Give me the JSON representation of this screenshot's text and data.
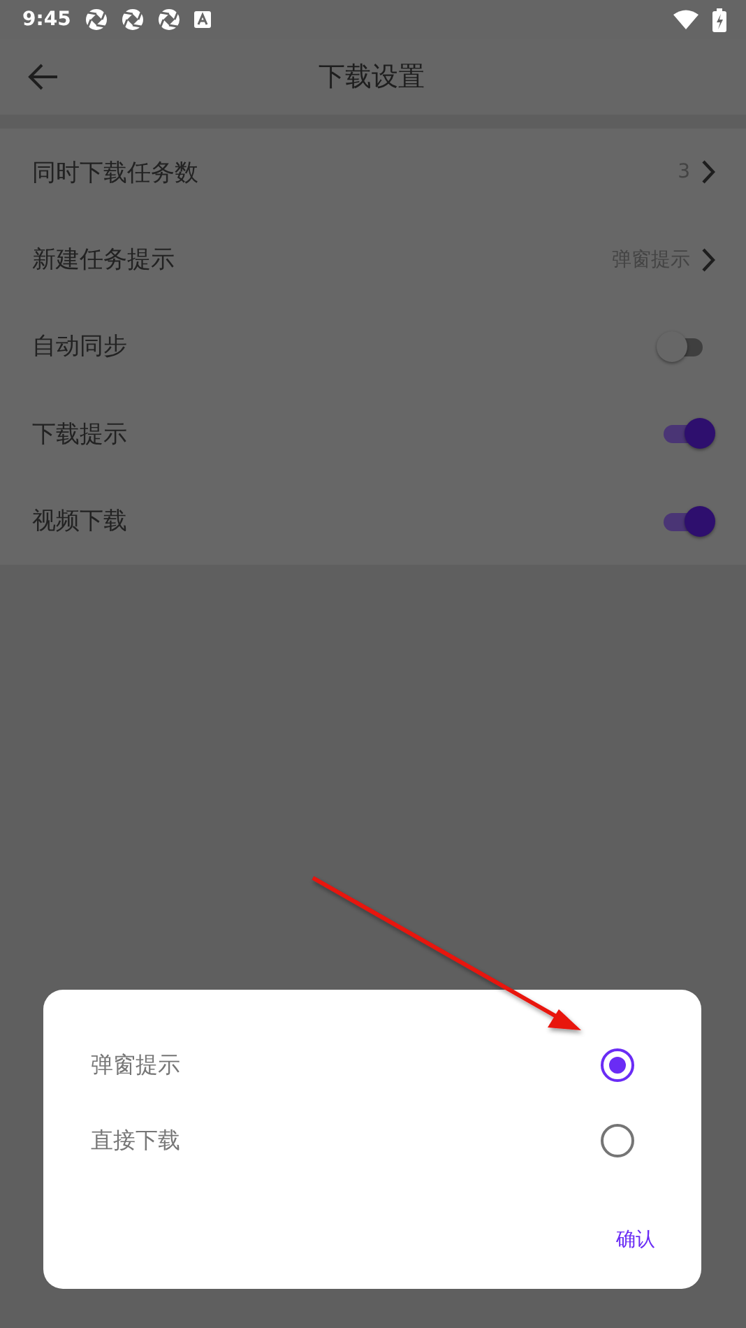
{
  "status_bar": {
    "time": "9:45"
  },
  "app_bar": {
    "title": "下载设置"
  },
  "settings": [
    {
      "kind": "value",
      "label": "同时下载任务数",
      "value": "3"
    },
    {
      "kind": "value",
      "label": "新建任务提示",
      "value": "弹窗提示"
    },
    {
      "kind": "toggle",
      "label": "自动同步",
      "on": false
    },
    {
      "kind": "toggle",
      "label": "下载提示",
      "on": true
    },
    {
      "kind": "toggle",
      "label": "视频下载",
      "on": true
    }
  ],
  "dialog": {
    "options": [
      {
        "label": "弹窗提示",
        "selected": true
      },
      {
        "label": "直接下载",
        "selected": false
      }
    ],
    "confirm": "确认"
  }
}
